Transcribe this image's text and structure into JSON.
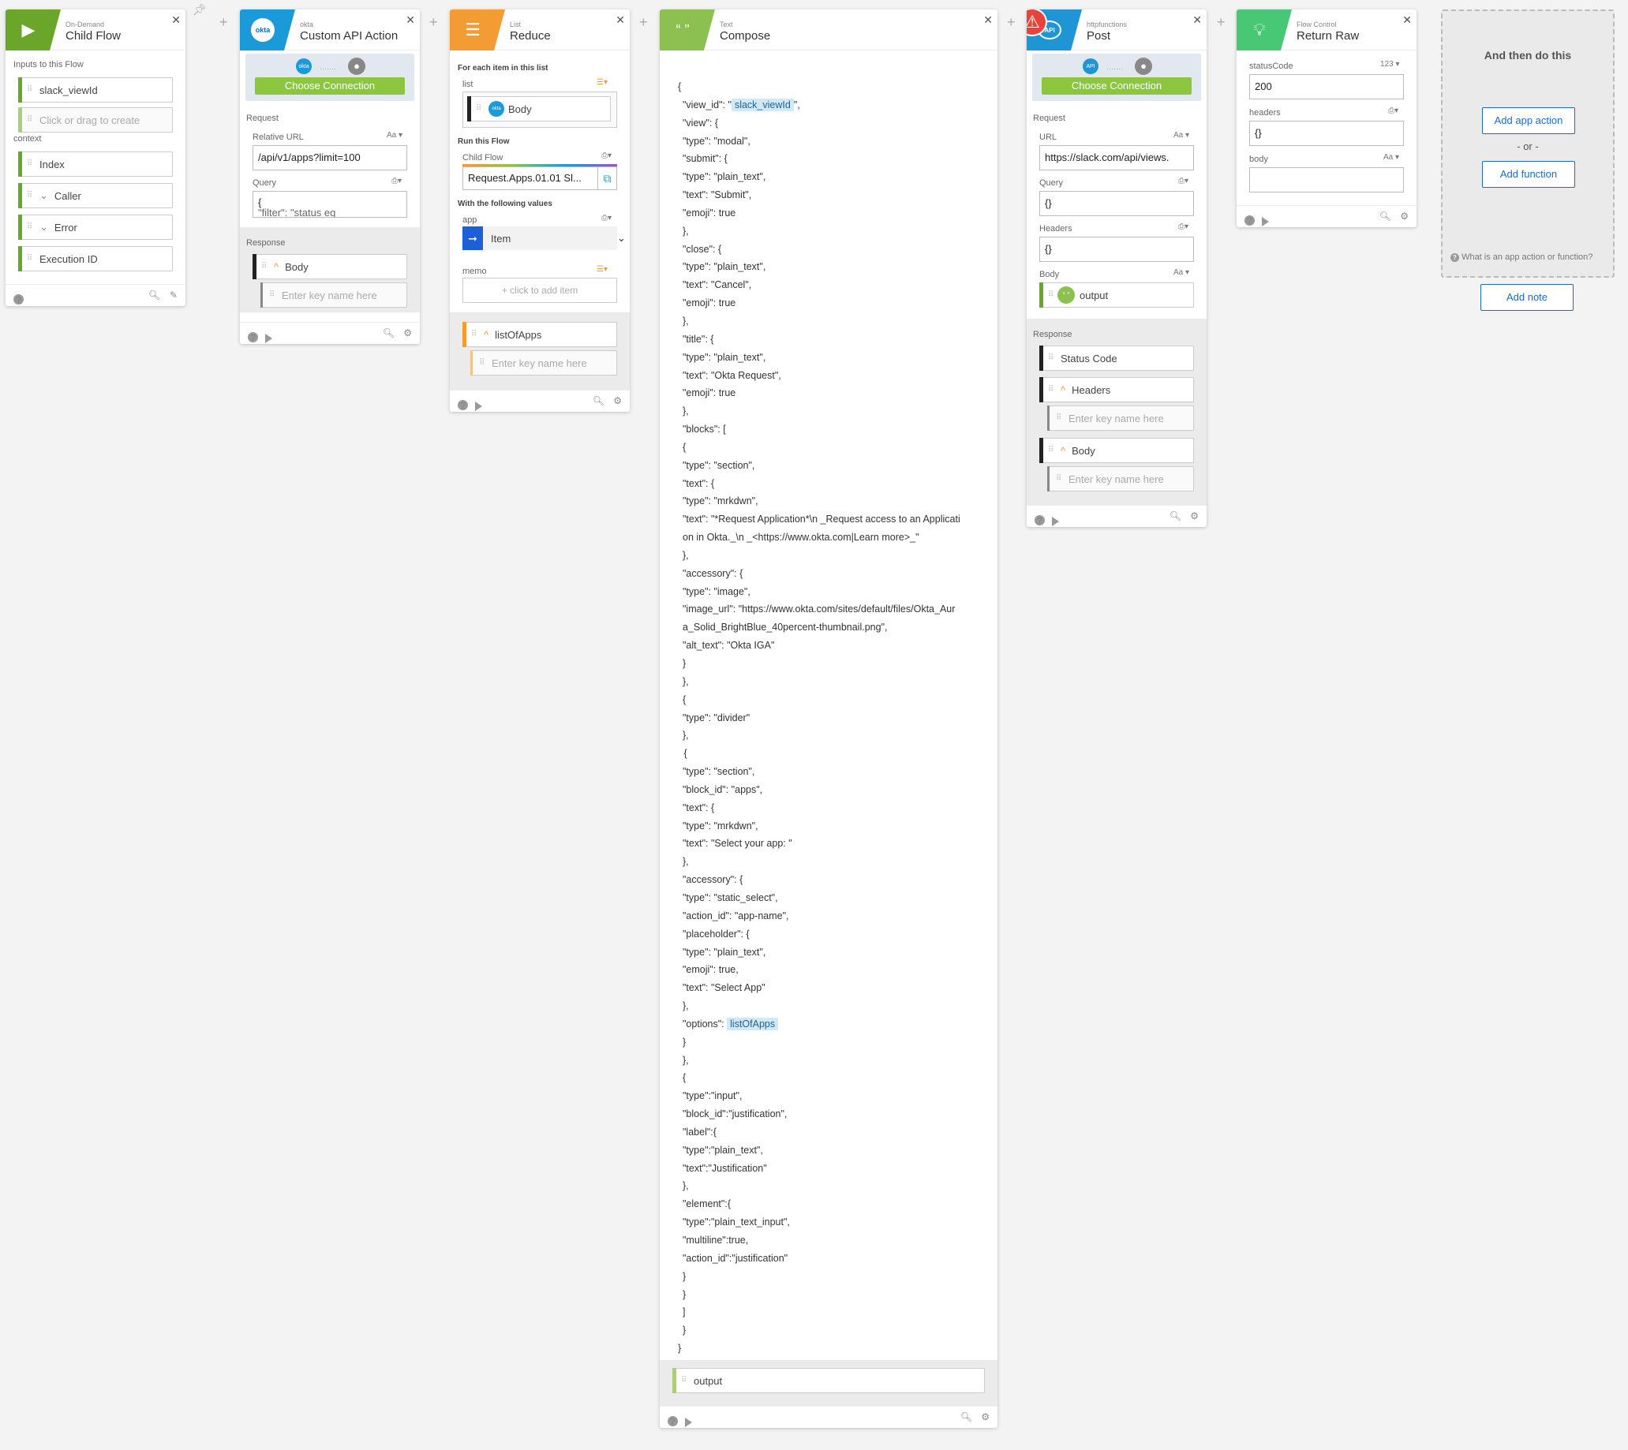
{
  "cards": {
    "child_flow": {
      "category": "On-Demand",
      "title": "Child Flow",
      "inputs_label": "Inputs to this Flow",
      "inputs": [
        "slack_viewId"
      ],
      "create_placeholder": "Click or drag to create",
      "context_label": "context",
      "context": [
        "Index",
        "Caller",
        "Error",
        "Execution ID"
      ]
    },
    "custom_api": {
      "category": "okta",
      "title": "Custom API Action",
      "logo_text": "okta",
      "connection_button": "Choose Connection",
      "request_label": "Request",
      "relative_url_label": "Relative URL",
      "relative_url_type": "Aa",
      "relative_url_value": "/api/v1/apps?limit=100",
      "query_label": "Query",
      "query_value": "{",
      "query_value_2": "\"filter\": \"status eq",
      "response_label": "Response",
      "body_label": "Body",
      "key_placeholder": "Enter key name here"
    },
    "reduce": {
      "category": "List",
      "title": "Reduce",
      "for_each_label": "For each item in this list",
      "list_label": "list",
      "list_item": "Body",
      "run_flow_label": "Run this Flow",
      "child_flow_label": "Child Flow",
      "child_flow_value": "Request.Apps.01.01 Sl...",
      "with_values_label": "With the following values",
      "app_label": "app",
      "app_value": "Item",
      "memo_label": "memo",
      "memo_placeholder": "+ click to add item",
      "output_item": "listOfApps",
      "key_placeholder": "Enter key name here"
    },
    "compose": {
      "category": "Text",
      "title": "Compose",
      "json_lines": [
        "{",
        "\"view_id\": \"",
        "\"view\": {",
        "\"type\": \"modal\",",
        "\"submit\": {",
        "\"type\": \"plain_text\",",
        "\"text\": \"Submit\",",
        "\"emoji\": true",
        "},",
        "\"close\": {",
        "\"type\": \"plain_text\",",
        "\"text\": \"Cancel\",",
        "\"emoji\": true",
        "},",
        "\"title\": {",
        "\"type\": \"plain_text\",",
        "\"text\": \"Okta Request\",",
        "\"emoji\": true",
        "},",
        "\"blocks\": [",
        "{",
        "\"type\": \"section\",",
        "\"text\": {",
        "\"type\": \"mrkdwn\",",
        "\"text\": \"*Request Application*\\n _Request access to an Applicati",
        "on in Okta._\\n _<https://www.okta.com|Learn more>_\"",
        "},",
        "\"accessory\": {",
        "\"type\": \"image\",",
        "\"image_url\": \"https://www.okta.com/sites/default/files/Okta_Aur",
        "a_Solid_BrightBlue_40percent-thumbnail.png\",",
        "\"alt_text\": \"Okta IGA\"",
        "}",
        "},",
        "{",
        "\"type\": \"divider\"",
        "},",
        " {",
        "\"type\": \"section\",",
        "\"block_id\": \"apps\",",
        "\"text\": {",
        "\"type\": \"mrkdwn\",",
        "\"text\": \"Select your app: \"",
        "},",
        "\"accessory\": {",
        "\"type\": \"static_select\",",
        "\"action_id\": \"app-name\",",
        "\"placeholder\": {",
        "\"type\": \"plain_text\",",
        "\"emoji\": true,",
        "\"text\": \"Select App\"",
        "},",
        "\"options\": ",
        "}",
        "},",
        "{",
        "\"type\":\"input\",",
        "\"block_id\":\"justification\",",
        "\"label\":{",
        "\"type\":\"plain_text\",",
        "\"text\":\"Justification\"",
        "},",
        "\"element\":{",
        "\"type\":\"plain_text_input\",",
        "\"multiline\":true,",
        "\"action_id\":\"justification\"",
        "}",
        "}",
        "]",
        "}",
        "}"
      ],
      "chip_view_id": "slack_viewId",
      "chip_view_id_suffix": "\",",
      "chip_options": "listOfApps",
      "output_label": "output"
    },
    "post": {
      "category": "httpfunctions",
      "title": "Post",
      "logo_text": "API",
      "connection_button": "Choose Connection",
      "request_label": "Request",
      "url_label": "URL",
      "url_type": "Aa",
      "url_value": "https://slack.com/api/views.",
      "query_label": "Query",
      "query_value": "{}",
      "headers_label": "Headers",
      "headers_value": "{}",
      "body_label": "Body",
      "body_type": "Aa",
      "body_value": "output",
      "response_label": "Response",
      "response_items": [
        "Status Code",
        "Headers",
        "Body"
      ],
      "key_placeholder": "Enter key name here"
    },
    "return_raw": {
      "category": "Flow Control",
      "title": "Return Raw",
      "status_label": "statusCode",
      "status_type": "123",
      "status_value": "200",
      "headers_label": "headers",
      "headers_value": "{}",
      "body_label": "body",
      "body_type": "Aa"
    }
  },
  "next_step": {
    "title": "And then do this",
    "add_app_action": "Add app action",
    "or": "- or -",
    "add_function": "Add function",
    "help": "What is an app action or function?",
    "add_note": "Add note"
  },
  "colors": {
    "child_flow": "#6aa629",
    "okta": "#1a9ad9",
    "list": "#f39c33",
    "text": "#8cc152",
    "http": "#1f95d6",
    "flow_control": "#48c774",
    "button_green": "#8cc63f",
    "link_blue": "#1d6bbf"
  }
}
